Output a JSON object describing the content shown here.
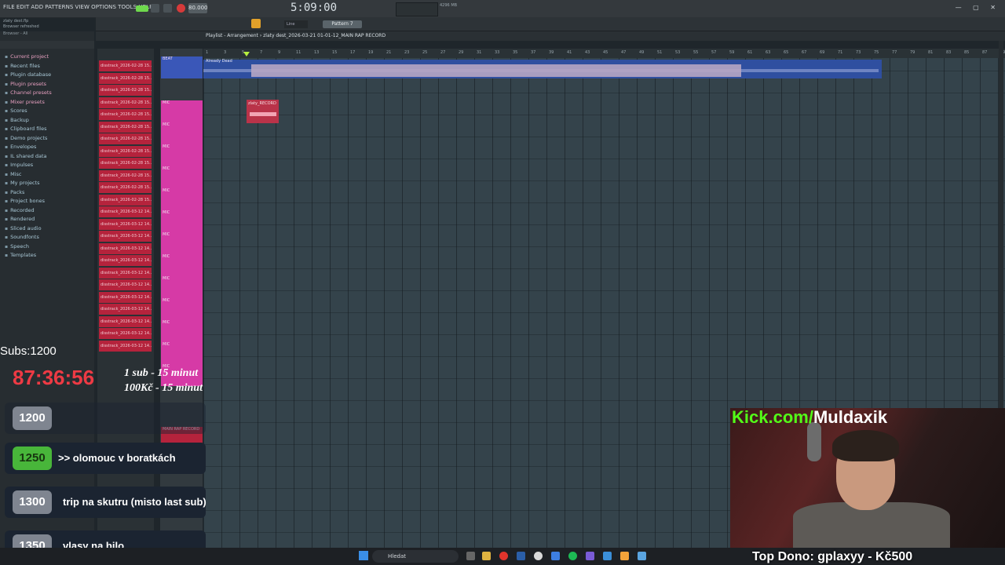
{
  "menu": [
    "FILE",
    "EDIT",
    "ADD",
    "PATTERNS",
    "VIEW",
    "OPTIONS",
    "TOOLS",
    "HELP"
  ],
  "hint": {
    "line1": "zlaty dest.flp",
    "line2": "Browser refreshed"
  },
  "transport": {
    "tempo": "80.000",
    "time": "5:09:00",
    "cpu": "4296 MB"
  },
  "toolbar": {
    "snap": "Line",
    "pattern": "Pattern 7"
  },
  "browser": {
    "title": "Browser - All",
    "items": [
      {
        "label": "Current project",
        "hl": true
      },
      {
        "label": "Recent files",
        "hl": false
      },
      {
        "label": "Plugin database",
        "hl": false
      },
      {
        "label": "Plugin presets",
        "hl": true
      },
      {
        "label": "Channel presets",
        "hl": true
      },
      {
        "label": "Mixer presets",
        "hl": true
      },
      {
        "label": "Scores",
        "hl": false
      },
      {
        "label": "Backup",
        "hl": false
      },
      {
        "label": "Clipboard files",
        "hl": false
      },
      {
        "label": "Demo projects",
        "hl": false
      },
      {
        "label": "Envelopes",
        "hl": false
      },
      {
        "label": "IL shared data",
        "hl": false
      },
      {
        "label": "Impulses",
        "hl": false
      },
      {
        "label": "Misc",
        "hl": false
      },
      {
        "label": "My projects",
        "hl": false
      },
      {
        "label": "Packs",
        "hl": false
      },
      {
        "label": "Project bones",
        "hl": false
      },
      {
        "label": "Recorded",
        "hl": false
      },
      {
        "label": "Rendered",
        "hl": false
      },
      {
        "label": "Sliced audio",
        "hl": false
      },
      {
        "label": "Soundfonts",
        "hl": false
      },
      {
        "label": "Speech",
        "hl": false
      },
      {
        "label": "Templates",
        "hl": false
      }
    ]
  },
  "playlist": {
    "title": "Playlist - Arrangement › zlaty dest_2026-03-21 01-01-12_MAIN RAP RECORD",
    "clips": [
      "disstrack_2026-02-28 15..",
      "disstrack_2026-02-28 15..",
      "disstrack_2026-02-28 15..",
      "disstrack_2026-02-28 15..",
      "disstrack_2026-02-28 15..",
      "disstrack_2026-02-28 15..",
      "disstrack_2026-02-28 15..",
      "disstrack_2026-02-28 15..",
      "disstrack_2026-02-28 15..",
      "disstrack_2026-02-28 15..",
      "disstrack_2026-02-28 15..",
      "disstrack_2026-02-28 15..",
      "disstrack_2026-03-12 14..",
      "disstrack_2026-03-12 14..",
      "disstrack_2026-03-12 14..",
      "disstrack_2026-03-12 14..",
      "disstrack_2026-03-12 14..",
      "disstrack_2026-03-12 14..",
      "disstrack_2026-03-12 14..",
      "disstrack_2026-03-12 14..",
      "disstrack_2026-03-12 14..",
      "disstrack_2026-03-12 14..",
      "disstrack_2026-03-12 14..",
      "disstrack_2026-03-12 14.."
    ],
    "tracks": {
      "beat": "BEAT",
      "mic": "MIC",
      "main": "MAIN RAP RECORD"
    },
    "beat_clip": "Already Dead",
    "rec_clip": "zlaty_RECORD",
    "ruler": [
      "1",
      "3",
      "5",
      "7",
      "9",
      "11",
      "13",
      "15",
      "17",
      "19",
      "21",
      "23",
      "25",
      "27",
      "29",
      "31",
      "33",
      "35",
      "37",
      "39",
      "41",
      "43",
      "45",
      "47",
      "49",
      "51",
      "53",
      "55",
      "57",
      "59",
      "61",
      "63",
      "65",
      "67",
      "69",
      "71",
      "73",
      "75",
      "77",
      "79",
      "81",
      "83",
      "85",
      "87",
      "89"
    ]
  },
  "overlay": {
    "subs": "Subs:1200",
    "timer": "87:36:56",
    "rule1": "1 sub - 15 minut",
    "rule2": "100Kč - 15 minut",
    "goals": [
      {
        "num": "1200",
        "text": "",
        "dim": true
      },
      {
        "num": "1250",
        "text": ">> olomouc v boratkách",
        "dim": false,
        "green": true
      },
      {
        "num": "1300",
        "text": "trip na skutru (misto last sub)",
        "dim": false
      },
      {
        "num": "1350",
        "text": "vlasy na bilo",
        "dim": false
      }
    ],
    "kick_prefix": "Kick.com/",
    "kick_name": "Muldaxik",
    "top_dono": "Top Dono: gplaxyy - Kč500"
  },
  "taskbar": {
    "search": "Hledat"
  },
  "colors": {
    "accent": "#53fc18",
    "timer": "#ee3a44",
    "clip": "#b5233c",
    "mic": "#d63aa6"
  }
}
